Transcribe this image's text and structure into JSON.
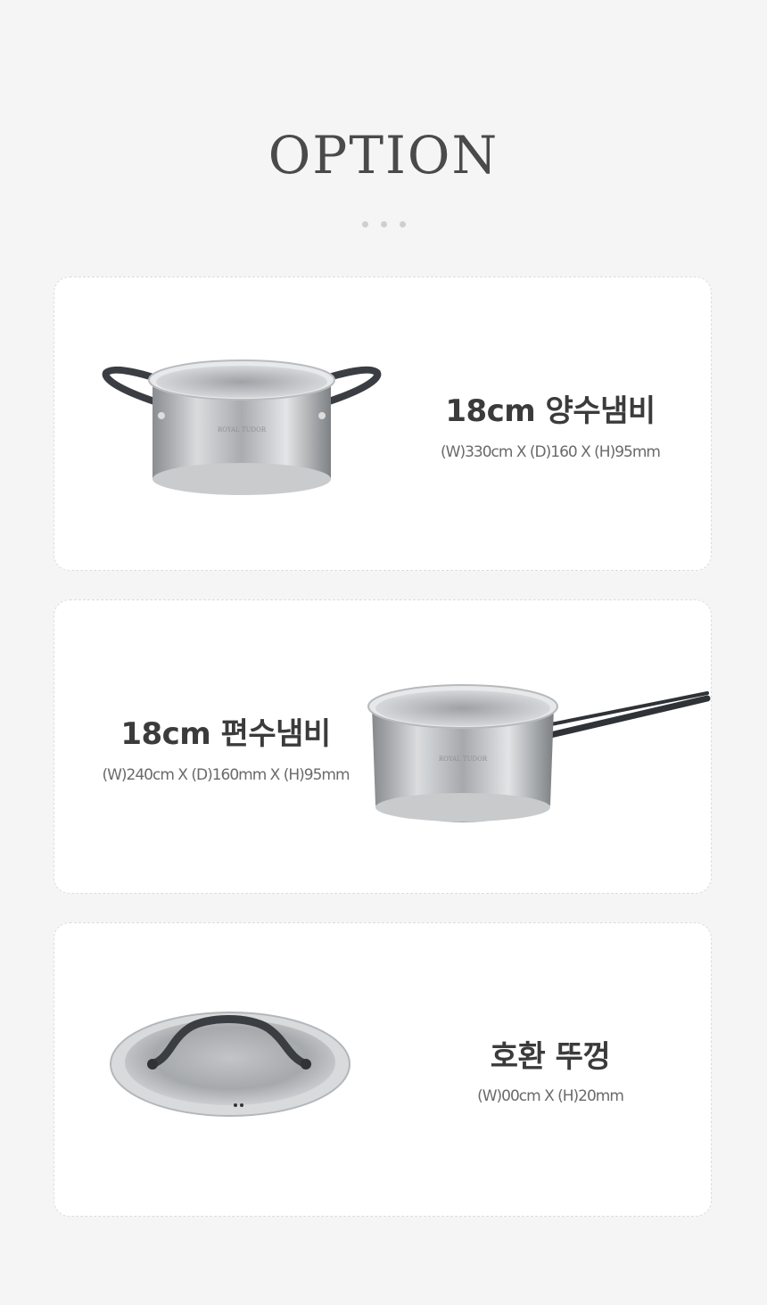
{
  "header": {
    "title": "OPTION"
  },
  "products": [
    {
      "name": "18cm 양수냄비",
      "spec": "(W)330cm X (D)160 X (H)95mm",
      "image": "two-handle-pot",
      "logo_text": "ROYAL TUDOR"
    },
    {
      "name": "18cm 편수냄비",
      "spec": "(W)240cm X (D)160mm X (H)95mm",
      "image": "single-handle-saucepan",
      "logo_text": "ROYAL TUDOR"
    },
    {
      "name": "호환 뚜껑",
      "spec": "(W)00cm X (H)20mm",
      "image": "pot-lid"
    }
  ],
  "colors": {
    "background": "#f5f5f5",
    "card": "#ffffff",
    "text_dark": "#3b3b3b",
    "text_spec": "#6a6a6a"
  }
}
